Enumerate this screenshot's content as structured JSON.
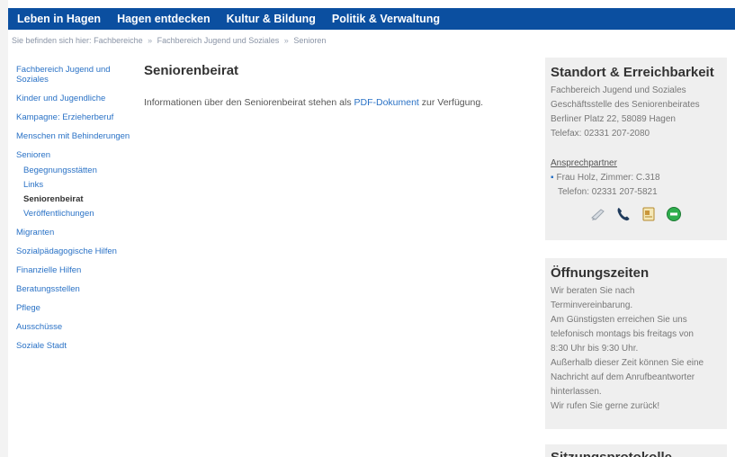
{
  "topnav": {
    "items": [
      "Leben in Hagen",
      "Hagen entdecken",
      "Kultur & Bildung",
      "Politik & Verwaltung"
    ]
  },
  "breadcrumb": {
    "prefix": "Sie befinden sich hier:",
    "items": [
      "Fachbereiche",
      "Fachbereich Jugend und Soziales",
      "Senioren"
    ],
    "separator": "»"
  },
  "sidebar": {
    "items": [
      "Fachbereich Jugend und Soziales",
      "Kinder und Jugendliche",
      "Kampagne: Erzieherberuf",
      "Menschen mit Behinderungen",
      "Senioren",
      "Migranten",
      "Sozialpädagogische Hilfen",
      "Finanzielle Hilfen",
      "Beratungsstellen",
      "Pflege",
      "Ausschüsse",
      "Soziale Stadt"
    ],
    "sub_items": [
      "Begegnungsstätten",
      "Links",
      "Seniorenbeirat",
      "Veröffentlichungen"
    ],
    "active_sub": "Seniorenbeirat"
  },
  "main": {
    "title": "Seniorenbeirat",
    "text_before": "Informationen über den Seniorenbeirat stehen als ",
    "link": "PDF-Dokument",
    "text_after": " zur Verfügung."
  },
  "standort": {
    "title": "Standort & Erreichbarkeit",
    "lines": [
      "Fachbereich Jugend und Soziales",
      "Geschäftsstelle des Seniorenbeirates",
      "Berliner Platz 22, 58089 Hagen",
      "Telefax: 02331 207-2080"
    ],
    "contact_label": "Ansprechpartner",
    "contact_person": "Frau Holz, Zimmer: C.318",
    "contact_phone": "Telefon: 02331 207-5821",
    "icons": [
      "email-icon",
      "phone-icon",
      "vcard-icon",
      "map-icon"
    ]
  },
  "oeffnungszeiten": {
    "title": "Öffnungszeiten",
    "lines": [
      "Wir beraten Sie nach",
      "Terminvereinbarung.",
      "Am Günstigsten erreichen Sie uns",
      "telefonisch montags bis freitags von",
      "8:30 Uhr bis 9:30 Uhr.",
      "Außerhalb dieser Zeit können Sie eine",
      "Nachricht auf dem Anrufbeantworter",
      "hinterlassen.",
      "Wir rufen Sie gerne zurück!"
    ]
  },
  "sitzung": {
    "title": "Sitzungsprotokolle"
  },
  "colors": {
    "nav_bg": "#0b4fa0",
    "link": "#2a72c6",
    "box_bg": "#efefef"
  }
}
